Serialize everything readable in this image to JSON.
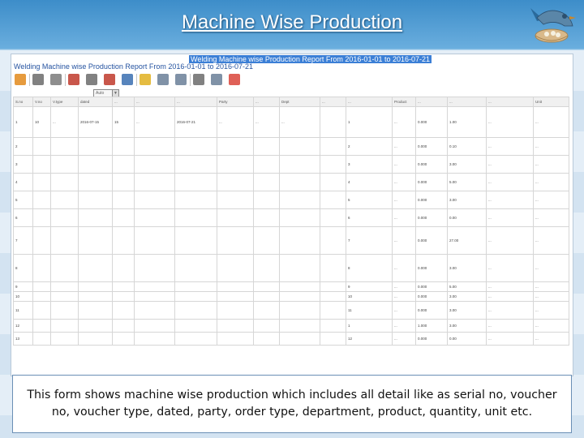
{
  "slide": {
    "title": "Machine Wise Production",
    "caption": "This form shows machine wise production which includes all detail like as serial no, voucher no, voucher type, dated, party, order type, department, product, quantity, unit etc."
  },
  "report": {
    "title": "Welding Machine wise Production Report From 2016-01-01 to 2016-07-21",
    "subtitle": "Welding Machine wise Production Report From 2016-01-01 to 2016-07-21",
    "select_value": "Auto"
  },
  "toolbar": {
    "buttons": [
      "refresh-icon",
      "print-icon",
      "filter-icon",
      "clear-filter-icon",
      "sort-icon",
      "settings-icon",
      "search-icon",
      "highlight-icon",
      "table-icon",
      "font-icon",
      "export-icon",
      "grid-icon",
      "close-icon"
    ],
    "colors": [
      "#e28a1c",
      "#6b6b6b",
      "#7a7a7a",
      "#c0392b",
      "#6b6b6b",
      "#c0392b",
      "#3a6fb0",
      "#e0b020",
      "#6a7f98",
      "#6a7f98",
      "#6b6b6b",
      "#6a7f98",
      "#d9443a"
    ]
  },
  "grid": {
    "columns": [
      "S.no",
      "V.no",
      "V.type",
      "dated",
      "...",
      "...",
      "...",
      "Party",
      "...",
      "Dept",
      "...",
      "...",
      "Product",
      "...",
      "...",
      "...",
      "Unit"
    ],
    "rows": [
      [
        "1",
        "10",
        "...",
        "2016-07-15",
        "15",
        "...",
        "2016-07-21",
        "...",
        "...",
        "...",
        "",
        "1",
        "...",
        "0.000",
        "1.00",
        "...",
        "..."
      ],
      [
        "2",
        "",
        "",
        "",
        "",
        "",
        "",
        "",
        "",
        "",
        "",
        "2",
        "...",
        "0.000",
        "0.10",
        "...",
        "..."
      ],
      [
        "3",
        "",
        "",
        "",
        "",
        "",
        "",
        "",
        "",
        "",
        "",
        "3",
        "...",
        "0.000",
        "3.00",
        "...",
        "..."
      ],
      [
        "4",
        "",
        "",
        "",
        "",
        "",
        "",
        "",
        "",
        "",
        "",
        "4",
        "...",
        "0.000",
        "5.00",
        "...",
        "..."
      ],
      [
        "5",
        "",
        "",
        "",
        "",
        "",
        "",
        "",
        "",
        "",
        "",
        "5",
        "...",
        "0.000",
        "3.00",
        "...",
        "..."
      ],
      [
        "6",
        "",
        "",
        "",
        "",
        "",
        "",
        "",
        "",
        "",
        "",
        "6",
        "...",
        "0.000",
        "0.00",
        "...",
        "..."
      ],
      [
        "7",
        "",
        "",
        "",
        "",
        "",
        "",
        "",
        "",
        "",
        "",
        "7",
        "...",
        "0.000",
        "27.00",
        "...",
        "..."
      ],
      [
        "8",
        "",
        "",
        "",
        "",
        "",
        "",
        "",
        "",
        "",
        "",
        "8",
        "...",
        "0.000",
        "3.00",
        "...",
        "..."
      ],
      [
        "9",
        "",
        "",
        "",
        "",
        "",
        "",
        "",
        "",
        "",
        "",
        "9",
        "...",
        "0.000",
        "5.00",
        "...",
        "..."
      ],
      [
        "10",
        "",
        "",
        "",
        "",
        "",
        "",
        "",
        "",
        "",
        "",
        "10",
        "...",
        "0.000",
        "3.00",
        "...",
        "..."
      ],
      [
        "11",
        "",
        "",
        "",
        "",
        "",
        "",
        "",
        "",
        "",
        "",
        "11",
        "...",
        "0.000",
        "3.00",
        "...",
        "..."
      ],
      [
        "12",
        "",
        "",
        "",
        "",
        "",
        "",
        "",
        "",
        "",
        "",
        "1",
        "...",
        "1.000",
        "3.00",
        "...",
        "..."
      ],
      [
        "13",
        "",
        "",
        "",
        "",
        "",
        "",
        "",
        "",
        "",
        "",
        "12",
        "...",
        "0.000",
        "0.00",
        "...",
        "..."
      ]
    ]
  }
}
